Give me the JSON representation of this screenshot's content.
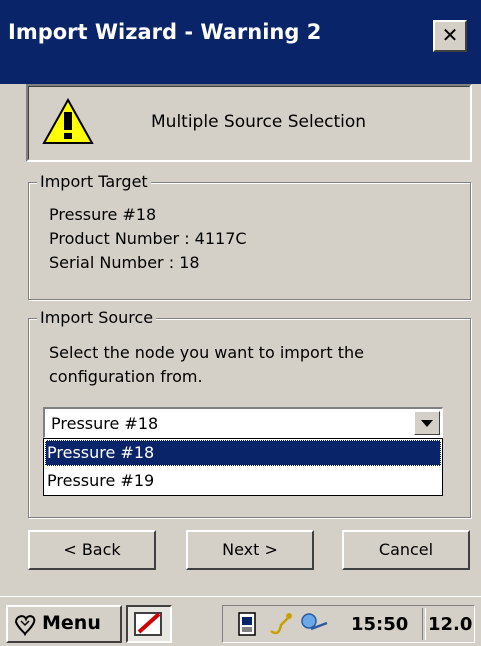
{
  "window": {
    "title": "Import Wizard - Warning 2",
    "close_label": "✕"
  },
  "banner": {
    "icon": "warning-icon",
    "text": "Multiple Source Selection"
  },
  "import_target": {
    "label": "Import Target",
    "lines": [
      "Pressure #18",
      "Product Number : 4117C",
      "Serial Number : 18"
    ]
  },
  "import_source": {
    "label": "Import Source",
    "instruction_line1": "Select the node you want to import the",
    "instruction_line2": "configuration from.",
    "selected": "Pressure #18",
    "options": [
      "Pressure #18",
      "Pressure #19"
    ]
  },
  "buttons": {
    "back": "< Back",
    "next": "Next >",
    "cancel": "Cancel"
  },
  "taskbar": {
    "start_label": "Menu",
    "clock": "15:50",
    "extra": "12.0",
    "tray_icons": [
      "sim-card-icon",
      "connection-icon",
      "network-icon"
    ]
  },
  "colors": {
    "title_bar": "#0a246a",
    "face": "#d4d0c8",
    "selection": "#0a246a",
    "warning_yellow": "#ffff00"
  }
}
